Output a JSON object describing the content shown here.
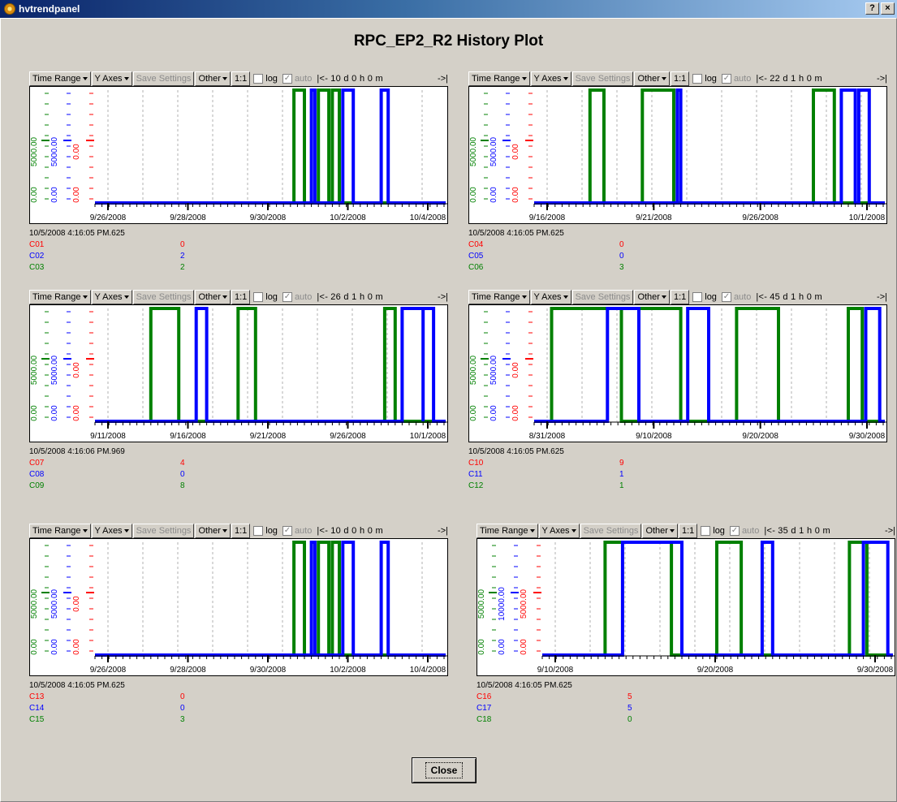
{
  "window": {
    "title": "hvtrendpanel",
    "help_glyph": "?",
    "close_glyph": "×"
  },
  "heading": "RPC_EP2_R2 History Plot",
  "toolbar": {
    "time_range": "Time Range",
    "y_axes": "Y Axes",
    "save_settings": "Save Settings",
    "other": "Other",
    "ratio": "1:1",
    "log": "log",
    "auto": "auto",
    "back": "|<-",
    "forward": "->|"
  },
  "colors": {
    "red": "#ff0000",
    "blue": "#0000ff",
    "green": "#008000"
  },
  "panels": [
    {
      "range": "10 d  0 h  0 m",
      "dates": [
        "9/26/2008",
        "9/28/2008",
        "9/30/2008",
        "10/2/2008",
        "10/4/2008"
      ],
      "timestamp": "10/5/2008 4:16:05 PM.625",
      "channels": [
        {
          "name": "C01",
          "value": "0"
        },
        {
          "name": "C02",
          "value": "2"
        },
        {
          "name": "C03",
          "value": "2"
        }
      ],
      "y_labels": [
        "5000.00",
        "5000.00",
        "0.00",
        "0.00",
        "0.00"
      ]
    },
    {
      "range": "22 d  1 h  0 m",
      "dates": [
        "9/16/2008",
        "9/21/2008",
        "9/26/2008",
        "10/1/2008"
      ],
      "timestamp": "10/5/2008 4:16:05 PM.625",
      "channels": [
        {
          "name": "C04",
          "value": "0"
        },
        {
          "name": "C05",
          "value": "0"
        },
        {
          "name": "C06",
          "value": "3"
        }
      ],
      "y_labels": [
        "5000.00",
        "5000.00",
        "0.00",
        "0.00",
        "0.00"
      ]
    },
    {
      "range": "26 d  1 h  0 m",
      "dates": [
        "9/11/2008",
        "9/16/2008",
        "9/21/2008",
        "9/26/2008",
        "10/1/2008"
      ],
      "timestamp": "10/5/2008 4:16:06 PM.969",
      "channels": [
        {
          "name": "C07",
          "value": "4"
        },
        {
          "name": "C08",
          "value": "0"
        },
        {
          "name": "C09",
          "value": "8"
        }
      ],
      "y_labels": [
        "5000.00",
        "5000.00",
        "0.00",
        "0.00",
        "0.00"
      ]
    },
    {
      "range": "45 d  1 h  0 m",
      "dates": [
        "8/31/2008",
        "9/10/2008",
        "9/20/2008",
        "9/30/2008"
      ],
      "timestamp": "10/5/2008 4:16:05 PM.625",
      "channels": [
        {
          "name": "C10",
          "value": "9"
        },
        {
          "name": "C11",
          "value": "1"
        },
        {
          "name": "C12",
          "value": "1"
        }
      ],
      "y_labels": [
        "5000.00",
        "5000.00",
        "0.00",
        "0.00",
        "0.00"
      ]
    },
    {
      "range": "10 d  0 h  0 m",
      "dates": [
        "9/26/2008",
        "9/28/2008",
        "9/30/2008",
        "10/2/2008",
        "10/4/2008"
      ],
      "timestamp": "10/5/2008 4:16:05 PM.625",
      "channels": [
        {
          "name": "C13",
          "value": "0"
        },
        {
          "name": "C14",
          "value": "0"
        },
        {
          "name": "C15",
          "value": "3"
        }
      ],
      "y_labels": [
        "5000.00",
        "5000.00",
        "0.00",
        "0.00",
        "0.00"
      ]
    },
    {
      "range": "35 d  1 h  0 m",
      "dates": [
        "9/10/2008",
        "9/20/2008",
        "9/30/2008"
      ],
      "timestamp": "10/5/2008 4:16:05 PM.625",
      "channels": [
        {
          "name": "C16",
          "value": "5"
        },
        {
          "name": "C17",
          "value": "5"
        },
        {
          "name": "C18",
          "value": "0"
        }
      ],
      "y_labels": [
        "5000.00",
        "10000.00",
        "5000.00",
        "0.00",
        "0.00"
      ]
    }
  ],
  "close_button": "Close"
}
